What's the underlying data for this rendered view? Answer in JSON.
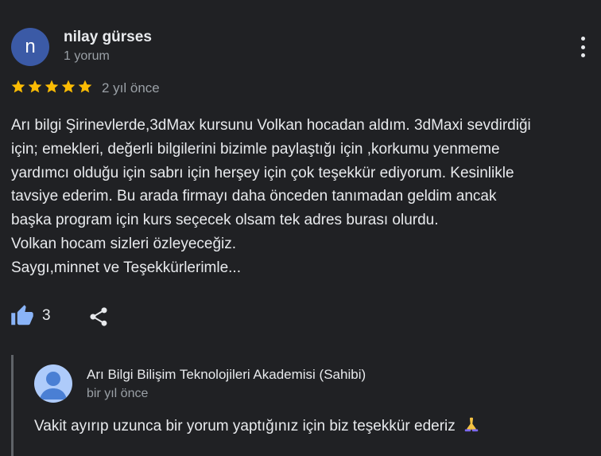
{
  "review": {
    "author": {
      "initial": "n",
      "name": "nilay gürses",
      "review_count": "1 yorum",
      "avatar_color": "#3b5aa6"
    },
    "rating": 5,
    "date": "2 yıl önce",
    "text_lines": [
      "Arı bilgi Şirinevlerde,3dMax kursunu Volkan hocadan aldım. 3dMaxi sevdirdiği",
      "için; emekleri, değerli bilgilerini bizimle paylaştığı için ,korkumu yenmeme",
      "yardımcı olduğu için sabrı için herşey için çok teşekkür ediyorum. Kesinlikle",
      "tavsiye ederim. Bu arada firmayı daha önceden tanımadan geldim ancak",
      "başka program için kurs seçecek olsam tek adres burası olurdu.",
      "Volkan hocam sizleri özleyeceğiz.",
      "Saygı,minnet ve Teşekkürlerimle..."
    ],
    "like_count": "3",
    "icons": {
      "like": "thumbs-up-icon",
      "share": "share-icon",
      "more": "more-vert-icon",
      "star": "star-icon"
    },
    "colors": {
      "star": "#fbbc04",
      "like": "#8ab4f8",
      "background": "#202124",
      "muted_text": "#9aa0a6"
    }
  },
  "owner_reply": {
    "name": "Arı Bilgi Bilişim Teknolojileri Akademisi (Sahibi)",
    "date": "bir yıl önce",
    "text": "Vakit ayırıp uzunca bir yorum yaptığınız için biz teşekkür ederiz",
    "emoji_icon": "praying-hands-icon"
  }
}
